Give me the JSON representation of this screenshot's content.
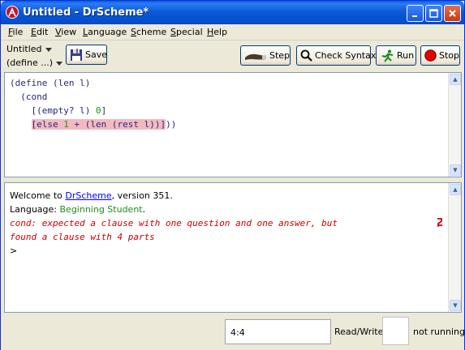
{
  "window": {
    "title": "Untitled - DrScheme*"
  },
  "menu": {
    "items": [
      {
        "label": "File",
        "mnemonic": "F",
        "rest": "ile"
      },
      {
        "label": "Edit",
        "mnemonic": "E",
        "rest": "dit"
      },
      {
        "label": "View",
        "mnemonic": "V",
        "rest": "iew"
      },
      {
        "label": "Language",
        "mnemonic": "L",
        "rest": "anguage"
      },
      {
        "label": "Scheme",
        "mnemonic": "S",
        "rest": "cheme"
      },
      {
        "label": "Special",
        "mnemonic": "S",
        "rest": "pecial"
      },
      {
        "label": "Help",
        "mnemonic": "H",
        "rest": "elp"
      }
    ]
  },
  "toolbar": {
    "file_menu_label": "Untitled",
    "define_menu_label": "(define ...)",
    "save_label": "Save",
    "step_label": "Step",
    "check_syntax_label": "Check Syntax",
    "run_label": "Run",
    "stop_label": "Stop"
  },
  "editor": {
    "line1": "(define (len l)",
    "line2_indent": "  ",
    "line2": "(cond",
    "line3_indent": "    ",
    "line3_open": "[(empty? l) ",
    "line3_zero": "0",
    "line3_close": "]",
    "line4_indent": "    ",
    "line4_else": "[else ",
    "line4_one": "1",
    "line4_rest": " + (len (rest l))]",
    "line4_tail": "))"
  },
  "interactions": {
    "welcome_prefix": "Welcome to ",
    "welcome_link": "DrScheme",
    "welcome_suffix": ", version 351.",
    "language_prefix": "Language: ",
    "language_value": "Beginning Student",
    "language_suffix": ".",
    "error_line1": "cond: expected a clause with one question and one answer, but",
    "error_line2": "found a clause with 4 parts",
    "prompt": ">"
  },
  "status": {
    "position": "4:4",
    "mode": "Read/Write",
    "run_status": "not running"
  },
  "colors": {
    "titlebar": "#0a5ce6",
    "keyword": "#262680",
    "literal": "#228b22",
    "error_highlight": "#f4b9bf",
    "error_text": "#cc0000",
    "link": "#0000ff"
  }
}
